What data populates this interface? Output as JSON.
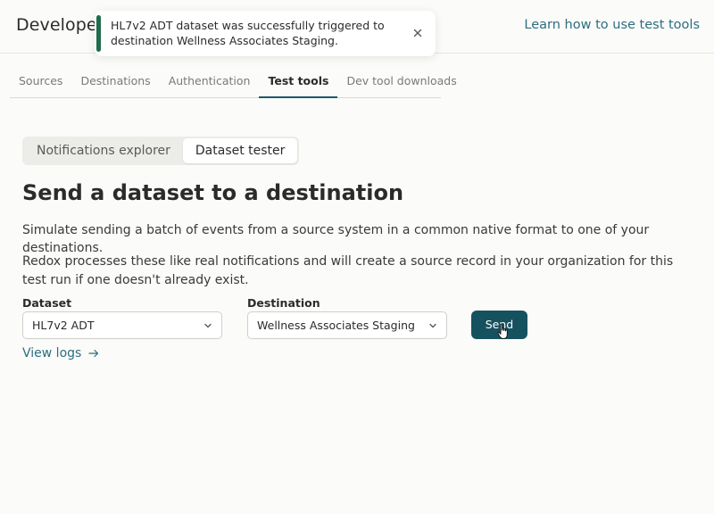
{
  "header": {
    "title": "Developer",
    "learn_link": "Learn how to use test tools"
  },
  "toast": {
    "message": "HL7v2 ADT dataset was successfully triggered to destination Wellness Associates Staging.",
    "status_color": "#1f6b4d",
    "close_icon": "close-icon"
  },
  "tabs": [
    {
      "label": "Sources",
      "active": false
    },
    {
      "label": "Destinations",
      "active": false
    },
    {
      "label": "Authentication",
      "active": false
    },
    {
      "label": "Test tools",
      "active": true
    },
    {
      "label": "Dev tool downloads",
      "active": false
    }
  ],
  "segmented": [
    {
      "label": "Notifications explorer",
      "active": false
    },
    {
      "label": "Dataset tester",
      "active": true
    }
  ],
  "main": {
    "heading": "Send a dataset to a destination",
    "description_1": "Simulate sending a batch of events from a source system in a common native format to one of your destinations.",
    "description_2": "Redox processes these like real notifications and will create a source record in your organization for this test run if one doesn't already exist."
  },
  "form": {
    "dataset_label": "Dataset",
    "dataset_value": "HL7v2 ADT",
    "destination_label": "Destination",
    "destination_value": "Wellness Associates Staging",
    "send_label": "Send",
    "send_color": "#16515f"
  },
  "view_logs": "View logs",
  "colors": {
    "accent_link": "#2e6e80",
    "tab_underline": "#1c5a6a"
  }
}
